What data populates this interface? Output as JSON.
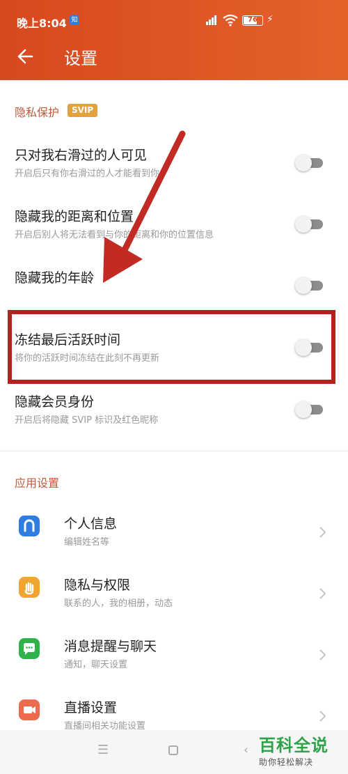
{
  "status_bar": {
    "time": "晚上8:04",
    "app_badge": "知",
    "battery": "76"
  },
  "header": {
    "title": "设置"
  },
  "privacy": {
    "section_title": "隐私保护",
    "badge": "SVIP",
    "rows": [
      {
        "title": "只对我右滑过的人可见",
        "subtitle": "开启后只有你右滑过的人才能看到你",
        "enabled": false
      },
      {
        "title": "隐藏我的距离和位置",
        "subtitle": "开启后别人将无法看到与你的距离和你的位置信息",
        "enabled": false
      },
      {
        "title": "隐藏我的年龄",
        "subtitle": "",
        "enabled": false
      },
      {
        "title": "冻结最后活跃时间",
        "subtitle": "将你的活跃时间冻结在此刻不再更新",
        "enabled": false
      },
      {
        "title": "隐藏会员身份",
        "subtitle": "开启后将隐藏 SVIP 标识及红色昵称",
        "enabled": false
      }
    ]
  },
  "app_settings": {
    "section_title": "应用设置",
    "items": [
      {
        "title": "个人信息",
        "subtitle": "编辑姓名等",
        "icon": "profile-icon",
        "color": "#2f7de1"
      },
      {
        "title": "隐私与权限",
        "subtitle": "联系的人，我的相册，动态",
        "icon": "hand-icon",
        "color": "#f0a531"
      },
      {
        "title": "消息提醒与聊天",
        "subtitle": "通知，聊天设置",
        "icon": "chat-icon",
        "color": "#2fb24c"
      },
      {
        "title": "直播设置",
        "subtitle": "直播间相关功能设置",
        "icon": "video-camera-icon",
        "color": "#ee6a4f"
      }
    ]
  },
  "watermark": {
    "main": "百科全说",
    "sub": "助你轻松解决"
  },
  "colors": {
    "header": "#d8481f",
    "highlight": "#b81f1f",
    "arrow": "#c22a24",
    "svip": "#e3a23d"
  }
}
